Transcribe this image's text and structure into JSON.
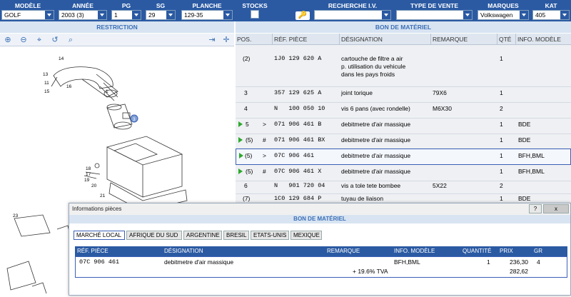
{
  "filters": {
    "modele": {
      "label": "MODÈLE",
      "value": "GOLF"
    },
    "annee": {
      "label": "ANNÉE",
      "value": "2003 (3)"
    },
    "pg": {
      "label": "PG",
      "value": "1"
    },
    "sg": {
      "label": "SG",
      "value": "29"
    },
    "planche": {
      "label": "PLANCHE",
      "value": "129-35"
    },
    "stocks": {
      "label": "STOCKS"
    },
    "recherche": {
      "label": "RECHERCHE I.V.",
      "value": ""
    },
    "type_vente": {
      "label": "TYPE DE VENTE",
      "value": ""
    },
    "marques": {
      "label": "MARQUES",
      "value": "Volkswagen"
    },
    "kat": {
      "label": "KAT",
      "value": "405"
    }
  },
  "sections": {
    "restriction": "RESTRICTION",
    "bom": "BON DE MATÉRIEL"
  },
  "diagram_labels": [
    "14",
    "13",
    "11",
    "15",
    "16",
    "3",
    "1",
    "18",
    "17",
    "19",
    "20",
    "21",
    "23"
  ],
  "parts_table": {
    "headers": {
      "pos": "POS.",
      "ref": "RÉF. PIÈCE",
      "designation": "DÉSIGNATION",
      "remarque": "REMARQUE",
      "qte": "QTÉ",
      "info": "INFO. MODÈLE"
    },
    "rows": [
      {
        "pos": "(2)",
        "flag": "",
        "ref": "1J0 129 620 A",
        "designation": "cartouche de filtre a air\np. utilisation du vehicule\ndans les pays froids",
        "remarque": "",
        "qte": "1",
        "info": "",
        "arrow": false
      },
      {
        "pos": "3",
        "flag": "",
        "ref": "357 129 625 A",
        "designation": "joint torique",
        "remarque": "79X6",
        "qte": "1",
        "info": "",
        "arrow": false
      },
      {
        "pos": "4",
        "flag": "",
        "ref": "N   100 050 10",
        "designation": "vis 6 pans (avec rondelle)",
        "remarque": "M6X30",
        "qte": "2",
        "info": "",
        "arrow": false
      },
      {
        "pos": "5",
        "flag": ">",
        "ref": "071 906 461 B",
        "designation": "debitmetre d'air massique",
        "remarque": "",
        "qte": "1",
        "info": "BDE",
        "arrow": true
      },
      {
        "pos": "(5)",
        "flag": "#",
        "ref": "071 906 461 BX",
        "designation": "debitmetre d'air massique",
        "remarque": "",
        "qte": "1",
        "info": "BDE",
        "arrow": true
      },
      {
        "pos": "(5)",
        "flag": ">",
        "ref": "07C 906 461",
        "designation": "debitmetre d'air massique",
        "remarque": "",
        "qte": "1",
        "info": "BFH,BML",
        "arrow": true
      },
      {
        "pos": "(5)",
        "flag": "#",
        "ref": "07C 906 461 X",
        "designation": "debitmetre d'air massique",
        "remarque": "",
        "qte": "1",
        "info": "BFH,BML",
        "arrow": true
      },
      {
        "pos": "6",
        "flag": "",
        "ref": "N   901 720 04",
        "designation": "vis a tole tete bombee",
        "remarque": "5X22",
        "qte": "2",
        "info": "",
        "arrow": false
      },
      {
        "pos": "(7)",
        "flag": "",
        "ref": "1C0 129 684 P",
        "designation": "tuyau de liaison",
        "remarque": "",
        "qte": "1",
        "info": "BDE",
        "arrow": false
      }
    ]
  },
  "popup": {
    "title": "Informations pièces",
    "help": "?",
    "close": "x",
    "bom": "BON DE MATÉRIEL",
    "tabs": [
      "MARCHÉ LOCAL",
      "AFRIQUE DU SUD",
      "ARGENTINE",
      "BRESIL",
      "ETATS-UNIS",
      "MEXIQUE"
    ],
    "headers": {
      "ref": "RÉF. PIÈCE",
      "designation": "DÉSIGNATION",
      "remarque": "REMARQUE",
      "info": "INFO. MODÈLE",
      "quantite": "QUANTITÉ",
      "prix": "PRIX",
      "gr": "GR"
    },
    "row": {
      "ref": "07C 906 461",
      "designation": "debitmetre d'air massique",
      "tva": "+ 19.6% TVA",
      "info": "BFH,BML",
      "quantite": "1",
      "prix": "236,30",
      "prix_ttc": "282,62",
      "gr": "4"
    }
  }
}
